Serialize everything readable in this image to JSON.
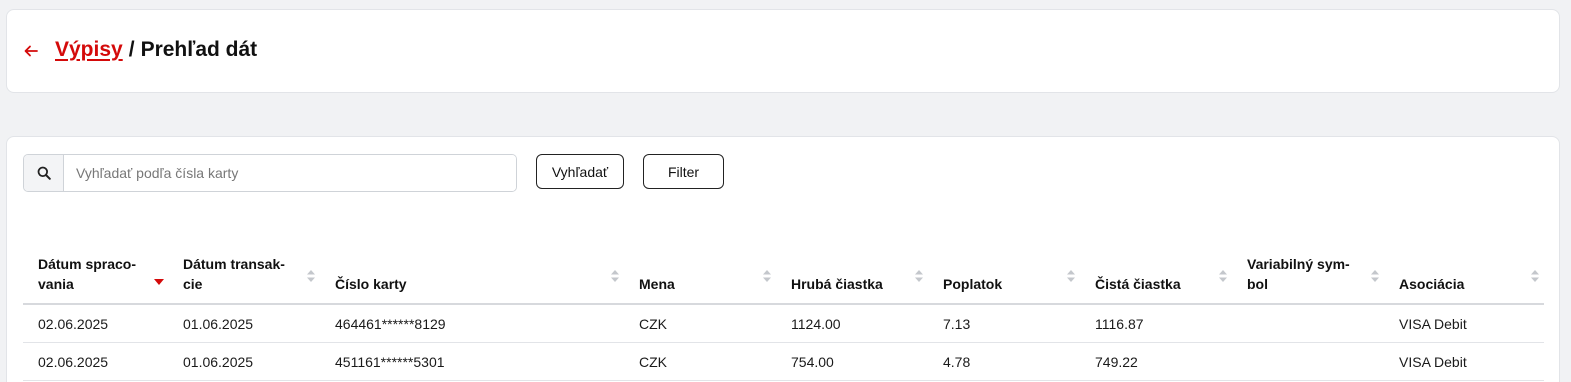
{
  "header": {
    "back_icon": "arrow-left-icon",
    "breadcrumb_link": "Výpisy",
    "separator": "/",
    "current": "Prehľad dát"
  },
  "toolbar": {
    "search_icon": "search-icon",
    "search_placeholder": "Vyhľadať podľa čísla karty",
    "search_value": "",
    "search_button": "Vyhľadať",
    "filter_button": "Filter"
  },
  "table": {
    "columns": [
      {
        "line1": "Dátum spraco-",
        "line2": "vania",
        "sort": "desc"
      },
      {
        "line1": "Dátum transak-",
        "line2": "cie",
        "sort": "none"
      },
      {
        "line1": "",
        "line2": "Číslo karty",
        "sort": "none"
      },
      {
        "line1": "",
        "line2": "Mena",
        "sort": "none"
      },
      {
        "line1": "",
        "line2": "Hrubá čiastka",
        "sort": "none"
      },
      {
        "line1": "",
        "line2": "Poplatok",
        "sort": "none"
      },
      {
        "line1": "",
        "line2": "Čistá čiastka",
        "sort": "none"
      },
      {
        "line1": "Variabilný sym-",
        "line2": "bol",
        "sort": "none"
      },
      {
        "line1": "",
        "line2": "Asociácia",
        "sort": "none"
      }
    ],
    "rows": [
      [
        "02.06.2025",
        "01.06.2025",
        "464461******8129",
        "CZK",
        "1124.00",
        "7.13",
        "1116.87",
        "",
        "VISA Debit"
      ],
      [
        "02.06.2025",
        "01.06.2025",
        "451161******5301",
        "CZK",
        "754.00",
        "4.78",
        "749.22",
        "",
        "VISA Debit"
      ]
    ]
  },
  "colors": {
    "accent": "#d40a0a",
    "background": "#f1f2f4",
    "card": "#ffffff",
    "sort_inactive": "#c4c7cc"
  }
}
